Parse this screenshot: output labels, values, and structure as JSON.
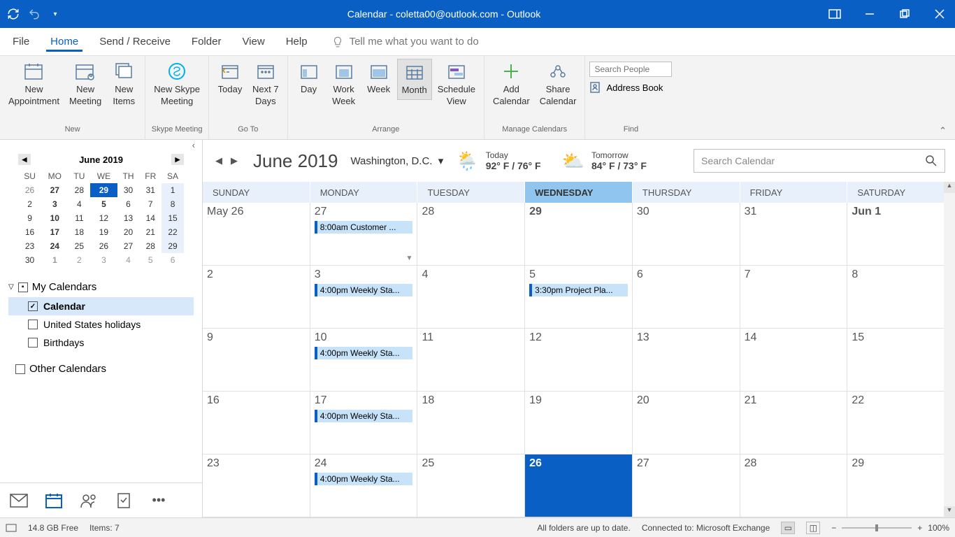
{
  "window": {
    "title": "Calendar - coletta00@outlook.com  -  Outlook"
  },
  "tabs": {
    "file": "File",
    "home": "Home",
    "sendreceive": "Send / Receive",
    "folder": "Folder",
    "view": "View",
    "help": "Help",
    "tellme": "Tell me what you want to do"
  },
  "ribbon": {
    "new_appointment": "New\nAppointment",
    "new_meeting": "New\nMeeting",
    "new_items": "New\nItems",
    "group_new": "New",
    "new_skype": "New Skype\nMeeting",
    "group_skype": "Skype Meeting",
    "today": "Today",
    "next7": "Next 7\nDays",
    "group_goto": "Go To",
    "day": "Day",
    "workweek": "Work\nWeek",
    "week": "Week",
    "month": "Month",
    "schedule": "Schedule\nView",
    "group_arrange": "Arrange",
    "add_cal": "Add\nCalendar",
    "share_cal": "Share\nCalendar",
    "group_manage": "Manage Calendars",
    "search_people": "Search People",
    "address_book": "Address Book",
    "group_find": "Find"
  },
  "minical": {
    "header": "June 2019",
    "dows": [
      "SU",
      "MO",
      "TU",
      "WE",
      "TH",
      "FR",
      "SA"
    ],
    "rows": [
      [
        {
          "d": "26",
          "dim": 1
        },
        {
          "d": "27",
          "bold": 1
        },
        {
          "d": "28"
        },
        {
          "d": "29",
          "today": 1
        },
        {
          "d": "30"
        },
        {
          "d": "31"
        },
        {
          "d": "1",
          "sat": 1
        }
      ],
      [
        {
          "d": "2"
        },
        {
          "d": "3",
          "bold": 1
        },
        {
          "d": "4"
        },
        {
          "d": "5",
          "bold": 1
        },
        {
          "d": "6"
        },
        {
          "d": "7"
        },
        {
          "d": "8",
          "sat": 1
        }
      ],
      [
        {
          "d": "9"
        },
        {
          "d": "10",
          "bold": 1
        },
        {
          "d": "11"
        },
        {
          "d": "12"
        },
        {
          "d": "13"
        },
        {
          "d": "14"
        },
        {
          "d": "15",
          "sat": 1
        }
      ],
      [
        {
          "d": "16"
        },
        {
          "d": "17",
          "bold": 1
        },
        {
          "d": "18"
        },
        {
          "d": "19"
        },
        {
          "d": "20"
        },
        {
          "d": "21"
        },
        {
          "d": "22",
          "sat": 1
        }
      ],
      [
        {
          "d": "23"
        },
        {
          "d": "24",
          "bold": 1
        },
        {
          "d": "25"
        },
        {
          "d": "26"
        },
        {
          "d": "27"
        },
        {
          "d": "28"
        },
        {
          "d": "29",
          "sat": 1
        }
      ],
      [
        {
          "d": "30"
        },
        {
          "d": "1",
          "bold": 1,
          "other": 1
        },
        {
          "d": "2",
          "other": 1
        },
        {
          "d": "3",
          "other": 1
        },
        {
          "d": "4",
          "other": 1
        },
        {
          "d": "5",
          "other": 1
        },
        {
          "d": "6",
          "other": 1
        }
      ]
    ]
  },
  "calendars": {
    "my_calendars": "My Calendars",
    "items": [
      {
        "label": "Calendar",
        "checked": true,
        "selected": true
      },
      {
        "label": "United States holidays",
        "checked": false
      },
      {
        "label": "Birthdays",
        "checked": false
      }
    ],
    "other": "Other Calendars"
  },
  "calmain": {
    "month_label": "June 2019",
    "location": "Washington,  D.C.",
    "today_label": "Today",
    "today_temps": "92° F / 76° F",
    "tomorrow_label": "Tomorrow",
    "tomorrow_temps": "84° F / 73° F",
    "search_placeholder": "Search Calendar",
    "day_headers": [
      "SUNDAY",
      "MONDAY",
      "TUESDAY",
      "WEDNESDAY",
      "THURSDAY",
      "FRIDAY",
      "SATURDAY"
    ],
    "weeks": [
      [
        {
          "label": "May 26"
        },
        {
          "label": "27",
          "events": [
            "8:00am Customer ..."
          ],
          "overflow": true
        },
        {
          "label": "28"
        },
        {
          "label": "29",
          "bold": true
        },
        {
          "label": "30"
        },
        {
          "label": "31"
        },
        {
          "label": "Jun 1",
          "bold": true
        }
      ],
      [
        {
          "label": "2"
        },
        {
          "label": "3",
          "events": [
            "4:00pm Weekly Sta..."
          ]
        },
        {
          "label": "4"
        },
        {
          "label": "5",
          "events": [
            "3:30pm Project Pla..."
          ]
        },
        {
          "label": "6"
        },
        {
          "label": "7"
        },
        {
          "label": "8"
        }
      ],
      [
        {
          "label": "9"
        },
        {
          "label": "10",
          "events": [
            "4:00pm Weekly Sta..."
          ]
        },
        {
          "label": "11"
        },
        {
          "label": "12"
        },
        {
          "label": "13"
        },
        {
          "label": "14"
        },
        {
          "label": "15"
        }
      ],
      [
        {
          "label": "16"
        },
        {
          "label": "17",
          "events": [
            "4:00pm Weekly Sta..."
          ]
        },
        {
          "label": "18"
        },
        {
          "label": "19"
        },
        {
          "label": "20"
        },
        {
          "label": "21"
        },
        {
          "label": "22"
        }
      ],
      [
        {
          "label": "23"
        },
        {
          "label": "24",
          "events": [
            "4:00pm Weekly Sta..."
          ]
        },
        {
          "label": "25"
        },
        {
          "label": "26",
          "today": true
        },
        {
          "label": "27"
        },
        {
          "label": "28"
        },
        {
          "label": "29"
        }
      ]
    ]
  },
  "status": {
    "free": "14.8 GB Free",
    "items": "Items: 7",
    "folders": "All folders are up to date.",
    "connected": "Connected to: Microsoft Exchange",
    "zoom": "100%"
  }
}
